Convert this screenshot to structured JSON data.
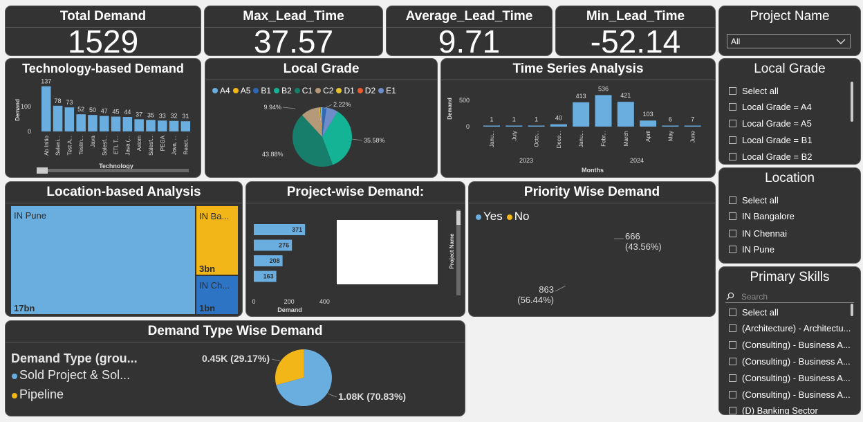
{
  "kpis": [
    {
      "label": "Total Demand",
      "value": "1529"
    },
    {
      "label": "Max_Lead_Time",
      "value": "37.57"
    },
    {
      "label": "Average_Lead_Time",
      "value": "9.71"
    },
    {
      "label": "Min_Lead_Time",
      "value": "-52.14"
    }
  ],
  "project_slicer": {
    "title": "Project Name",
    "selected": "All"
  },
  "local_grade_slicer": {
    "title": "Local Grade",
    "options": [
      "Select all",
      "Local Grade = A4",
      "Local Grade = A5",
      "Local Grade = B1",
      "Local Grade = B2"
    ]
  },
  "location_slicer": {
    "title": "Location",
    "options": [
      "Select all",
      "IN Bangalore",
      "IN Chennai",
      "IN Pune"
    ]
  },
  "skills_slicer": {
    "title": "Primary Skills",
    "search_placeholder": "Search",
    "options": [
      "Select all",
      "(Architecture) - Architectu...",
      "(Consulting) - Business A...",
      "(Consulting) - Business A...",
      "(Consulting) - Business A...",
      "(Consulting) - Business A...",
      "(D) Banking Sector"
    ]
  },
  "tech_chart": {
    "title": "Technology-based Demand",
    "chart_data": {
      "type": "bar",
      "categories": [
        "Ab Initio",
        "Seleni...",
        "Test A...",
        "Testin...",
        "Java",
        "Salesf...",
        "ETL T...",
        "Java (...",
        "Axiom",
        "Salesf...",
        "PEGA",
        "Java, ...",
        "React..."
      ],
      "values": [
        137,
        78,
        73,
        52,
        50,
        47,
        45,
        44,
        37,
        35,
        33,
        32,
        31
      ],
      "xlabel": "Technology",
      "ylabel": "Demand",
      "yticks": [
        "100",
        "0"
      ]
    }
  },
  "grade_chart": {
    "title": "Local Grade",
    "legend": [
      {
        "name": "A4",
        "color": "#6aaee0"
      },
      {
        "name": "A5",
        "color": "#f2b619"
      },
      {
        "name": "B1",
        "color": "#2e69b8"
      },
      {
        "name": "B2",
        "color": "#15b395"
      },
      {
        "name": "C1",
        "color": "#167e6a"
      },
      {
        "name": "C2",
        "color": "#b59a7a"
      },
      {
        "name": "D1",
        "color": "#e6c12e"
      },
      {
        "name": "D2",
        "color": "#e85a2b"
      },
      {
        "name": "E1",
        "color": "#6d8cc9"
      }
    ],
    "chart_data": {
      "type": "pie",
      "labels": [
        "A4",
        "A5",
        "B1",
        "B2",
        "C1",
        "C2",
        "D1",
        "D2",
        "E1"
      ],
      "values": [
        0.5,
        0.5,
        2.22,
        35.58,
        43.88,
        9.94,
        0.7,
        0.3,
        6.38
      ],
      "data_labels": [
        "9.94%",
        "2.22%",
        "35.58%",
        "43.88%"
      ]
    }
  },
  "time_chart": {
    "title": "Time Series Analysis",
    "chart_data": {
      "type": "bar",
      "categories": [
        "Janu...",
        "July",
        "Octo...",
        "Dece...",
        "Janu...",
        "Febr...",
        "March",
        "April",
        "May",
        "June"
      ],
      "values": [
        1,
        1,
        1,
        40,
        413,
        536,
        421,
        103,
        6,
        7
      ],
      "years": [
        "2023",
        "2024"
      ],
      "xlabel": "Months",
      "ylabel": "Demand",
      "yticks": [
        "500",
        "0"
      ]
    }
  },
  "location_chart": {
    "title": "Location-based Analysis",
    "tiles": [
      {
        "name": "IN Pune",
        "value": "17bn"
      },
      {
        "name": "IN Ba...",
        "value": "3bn"
      },
      {
        "name": "IN Ch...",
        "value": "1bn"
      }
    ]
  },
  "project_chart": {
    "title": "Project-wise Demand:",
    "chart_data": {
      "type": "bar",
      "values": [
        371,
        276,
        208,
        163
      ],
      "xlabel": "Demand",
      "ylabel": "Project Name",
      "xticks": [
        "0",
        "200",
        "400"
      ]
    }
  },
  "priority_chart": {
    "title": "Priority Wise Demand",
    "legend": [
      {
        "name": "Yes",
        "color": "#6aaee0"
      },
      {
        "name": "No",
        "color": "#f2b619"
      }
    ],
    "chart_data": {
      "type": "pie",
      "labels": [
        "Yes",
        "No"
      ],
      "values": [
        863,
        666
      ],
      "data_labels": [
        "666",
        "(43.56%)",
        "863",
        "(56.44%)"
      ]
    }
  },
  "demand_type_chart": {
    "title": "Demand Type Wise Demand",
    "legend_title": "Demand Type (grou...",
    "legend": [
      {
        "name": "Sold Project & Sol...",
        "color": "#6aaee0"
      },
      {
        "name": "Pipeline",
        "color": "#f2b619"
      }
    ],
    "chart_data": {
      "type": "pie",
      "labels": [
        "Sold Project & Sol...",
        "Pipeline"
      ],
      "values": [
        70.83,
        29.17
      ],
      "data_labels": [
        "0.45K (29.17%)",
        "1.08K (70.83%)"
      ]
    }
  }
}
